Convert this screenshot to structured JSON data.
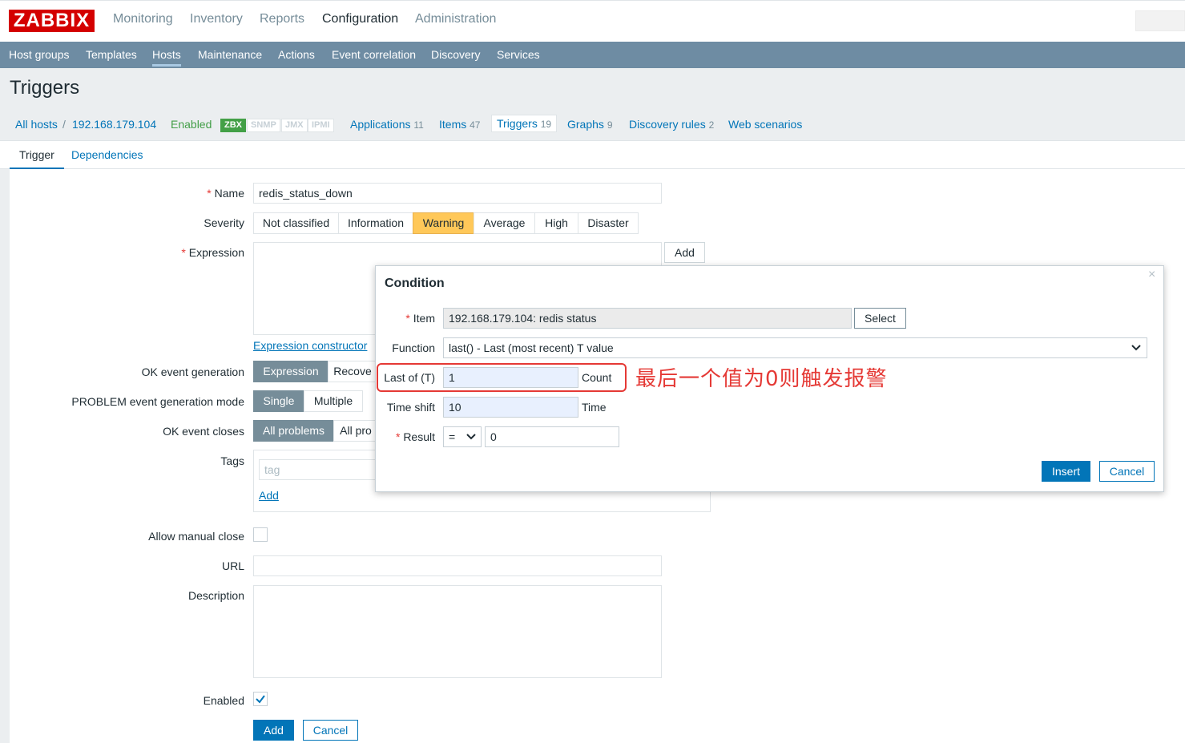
{
  "brand": {
    "logo": "ZABBIX"
  },
  "top_menu": [
    "Monitoring",
    "Inventory",
    "Reports",
    "Configuration",
    "Administration"
  ],
  "top_menu_active": "Configuration",
  "sub_menu": [
    "Host groups",
    "Templates",
    "Hosts",
    "Maintenance",
    "Actions",
    "Event correlation",
    "Discovery",
    "Services"
  ],
  "sub_menu_active": "Hosts",
  "page_title": "Triggers",
  "host_nav": {
    "all_hosts": "All hosts",
    "separator": "/",
    "host": "192.168.179.104",
    "status": "Enabled",
    "availability": [
      "ZBX",
      "SNMP",
      "JMX",
      "IPMI"
    ],
    "applications": {
      "label": "Applications",
      "count": "11"
    },
    "items": {
      "label": "Items",
      "count": "47"
    },
    "triggers": {
      "label": "Triggers",
      "count": "19"
    },
    "graphs": {
      "label": "Graphs",
      "count": "9"
    },
    "discovery": {
      "label": "Discovery rules",
      "count": "2"
    },
    "web": "Web scenarios"
  },
  "tabs": [
    "Trigger",
    "Dependencies"
  ],
  "form": {
    "name_label": "Name",
    "name_value": "redis_status_down",
    "severity_label": "Severity",
    "severity_options": [
      "Not classified",
      "Information",
      "Warning",
      "Average",
      "High",
      "Disaster"
    ],
    "severity_selected": "Warning",
    "expression_label": "Expression",
    "expression_add": "Add",
    "expression_constructor": "Expression constructor",
    "ok_event_label": "OK event generation",
    "ok_event_options": [
      "Expression",
      "Recove"
    ],
    "problem_mode_label": "PROBLEM event generation mode",
    "problem_mode_options": [
      "Single",
      "Multiple"
    ],
    "ok_closes_label": "OK event closes",
    "ok_closes_options": [
      "All problems",
      "All pro"
    ],
    "tags_label": "Tags",
    "tag_placeholder": "tag",
    "tags_add": "Add",
    "manual_close_label": "Allow manual close",
    "url_label": "URL",
    "description_label": "Description",
    "enabled_label": "Enabled",
    "add_button": "Add",
    "cancel_button": "Cancel"
  },
  "dialog": {
    "title": "Condition",
    "close": "×",
    "item_label": "Item",
    "item_value": "192.168.179.104: redis status",
    "select_button": "Select",
    "function_label": "Function",
    "function_value": "last() - Last (most recent) T value",
    "last_label": "Last of (T)",
    "last_value": "1",
    "last_unit": "Count",
    "shift_label": "Time shift",
    "shift_value": "10",
    "shift_unit": "Time",
    "result_label": "Result",
    "result_operator": "=",
    "result_value": "0",
    "insert_button": "Insert",
    "cancel_button": "Cancel"
  },
  "annotation": "最后一个值为0则触发报警",
  "colors": {
    "brand": "#d40000",
    "nav": "#6e8ca3",
    "link": "#0275b8",
    "warning": "#ffc859",
    "annotation": "#e53935"
  }
}
